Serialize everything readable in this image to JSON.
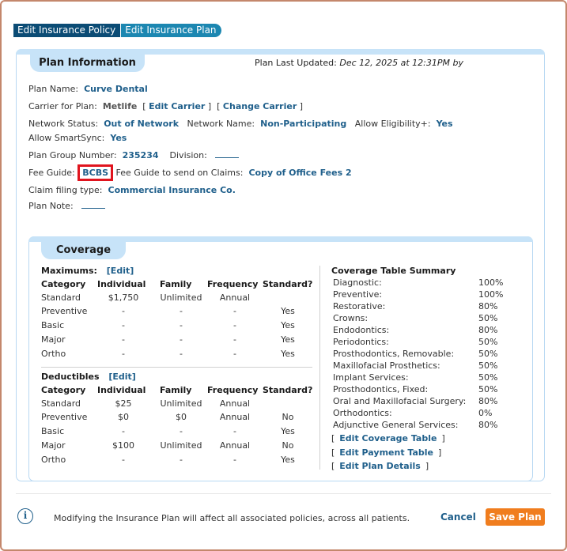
{
  "tabs": [
    "Edit Insurance Policy",
    "Edit Insurance Plan"
  ],
  "plan": {
    "section_title": "Plan Information",
    "updated_label": "Plan Last Updated:",
    "updated_value": "Dec 12, 2025 at 12:31PM by",
    "plan_name_label": "Plan Name:",
    "plan_name": "Curve Dental",
    "carrier_label": "Carrier for Plan:",
    "carrier": "Metlife",
    "edit_carrier": "Edit Carrier",
    "change_carrier": "Change Carrier",
    "network_status_label": "Network Status:",
    "network_status": "Out of Network",
    "network_name_label": "Network Name:",
    "network_name": "Non-Participating",
    "eligibility_label": "Allow Eligibility+:",
    "eligibility": "Yes",
    "smartsync_label": "Allow SmartSync:",
    "smartsync": "Yes",
    "group_number_label": "Plan Group Number:",
    "group_number": "235234",
    "division_label": "Division:",
    "fee_guide_label": "Fee Guide:",
    "fee_guide": "BCBS",
    "fee_guide_claims_label": "Fee Guide to send on Claims:",
    "fee_guide_claims": "Copy of Office Fees 2",
    "claim_type_label": "Claim filing type:",
    "claim_type": "Commercial Insurance Co.",
    "plan_note_label": "Plan Note:"
  },
  "coverage": {
    "section_title": "Coverage",
    "edit_label": "[Edit]",
    "maximums": {
      "title": "Maximums:",
      "headers": [
        "Category",
        "Individual",
        "Family",
        "Frequency",
        "Standard?"
      ],
      "rows": [
        [
          "Standard",
          "$1,750",
          "Unlimited",
          "Annual",
          ""
        ],
        [
          "Preventive",
          "-",
          "-",
          "-",
          "Yes"
        ],
        [
          "Basic",
          "-",
          "-",
          "-",
          "Yes"
        ],
        [
          "Major",
          "-",
          "-",
          "-",
          "Yes"
        ],
        [
          "Ortho",
          "-",
          "-",
          "-",
          "Yes"
        ]
      ]
    },
    "deductibles": {
      "title": "Deductibles",
      "headers": [
        "Category",
        "Individual",
        "Family",
        "Frequency",
        "Standard?"
      ],
      "rows": [
        [
          "Standard",
          "$25",
          "Unlimited",
          "Annual",
          ""
        ],
        [
          "Preventive",
          "$0",
          "$0",
          "Annual",
          "No"
        ],
        [
          "Basic",
          "-",
          "-",
          "-",
          "Yes"
        ],
        [
          "Major",
          "$100",
          "Unlimited",
          "Annual",
          "No"
        ],
        [
          "Ortho",
          "-",
          "-",
          "-",
          "Yes"
        ]
      ]
    },
    "summary": {
      "title": "Coverage Table Summary",
      "rows": [
        [
          "Diagnostic:",
          "100%"
        ],
        [
          "Preventive:",
          "100%"
        ],
        [
          "Restorative:",
          "80%"
        ],
        [
          "Crowns:",
          "50%"
        ],
        [
          "Endodontics:",
          "80%"
        ],
        [
          "Periodontics:",
          "50%"
        ],
        [
          "Prosthodontics, Removable:",
          "50%"
        ],
        [
          "Maxillofacial Prosthetics:",
          "50%"
        ],
        [
          "Implant Services:",
          "50%"
        ],
        [
          "Prosthodontics, Fixed:",
          "50%"
        ],
        [
          "Oral and Maxillofacial Surgery:",
          "80%"
        ],
        [
          "Orthodontics:",
          "0%"
        ],
        [
          "Adjunctive General Services:",
          "80%"
        ]
      ],
      "links": [
        "Edit Coverage Table",
        "Edit Payment Table",
        "Edit Plan Details"
      ]
    }
  },
  "footer": {
    "info_icon": "info-icon",
    "note": "Modifying the Insurance Plan will affect all associated policies, across all patients.",
    "cancel": "Cancel",
    "save": "Save Plan"
  }
}
